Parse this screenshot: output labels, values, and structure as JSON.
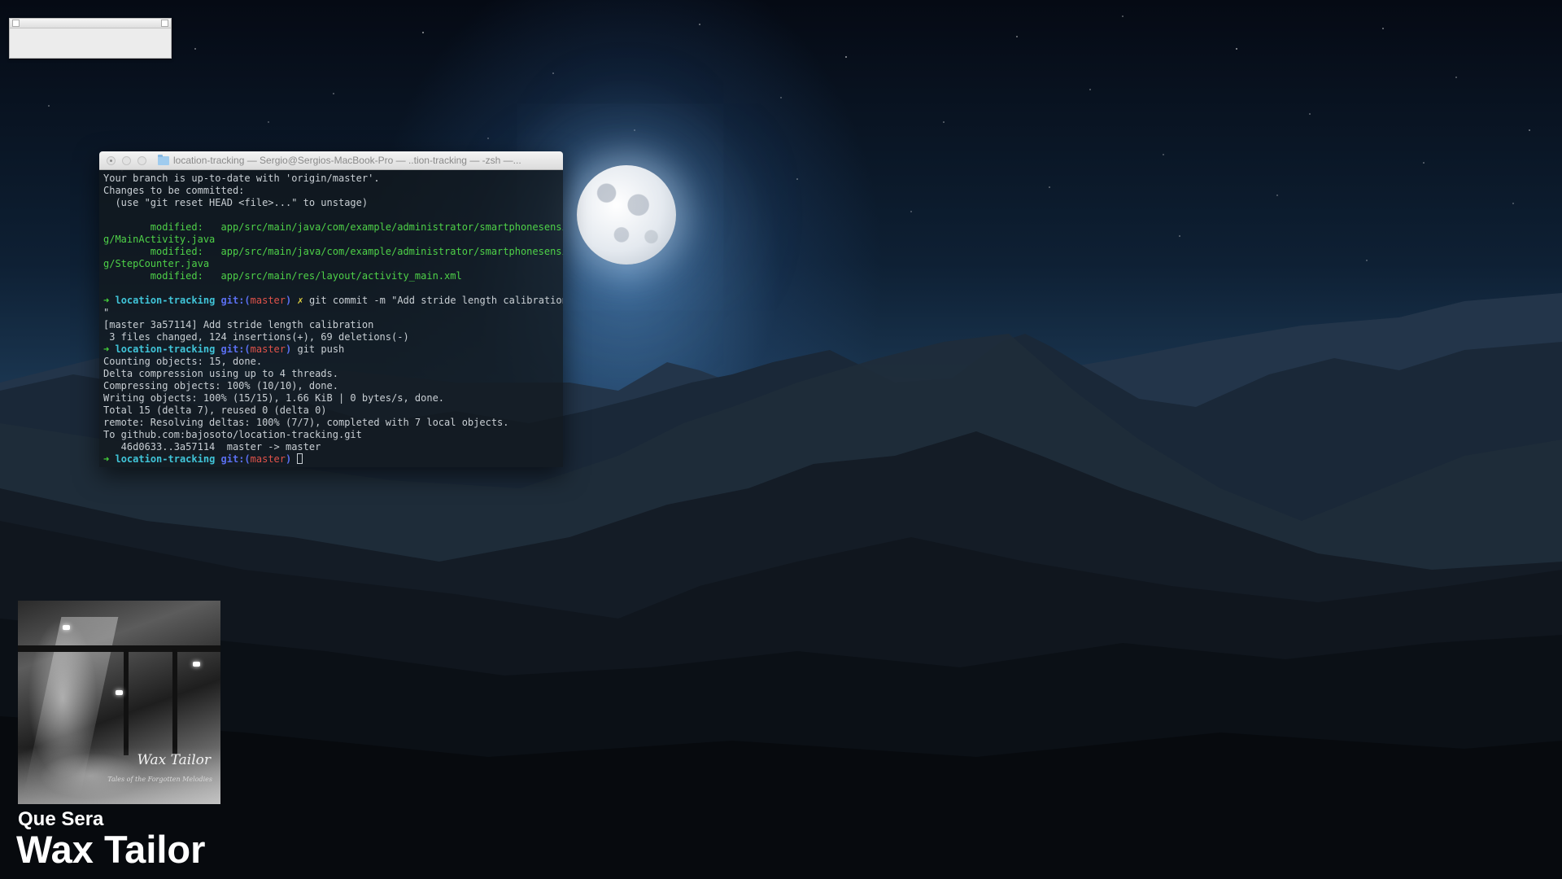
{
  "terminal": {
    "title": "location-tracking — Sergio@Sergios-MacBook-Pro — ..tion-tracking — -zsh —...",
    "prompt": {
      "arrow": "➜",
      "dir": "location-tracking",
      "git_label": "git:(",
      "branch": "master",
      "git_close": ")",
      "dirty_mark": "✗"
    },
    "lines": {
      "l1": "Your branch is up-to-date with 'origin/master'.",
      "l2": "Changes to be committed:",
      "l3": "  (use \"git reset HEAD <file>...\" to unstage)",
      "m1a": "        modified:   app/src/main/java/com/example/administrator/smartphonesensin",
      "m1b": "g/MainActivity.java",
      "m2a": "        modified:   app/src/main/java/com/example/administrator/smartphonesensin",
      "m2b": "g/StepCounter.java",
      "m3": "        modified:   app/src/main/res/layout/activity_main.xml",
      "cmd1": "git commit -m \"Add stride length calibration",
      "cmd1_cont": "\"",
      "c1": "[master 3a57114] Add stride length calibration",
      "c2": " 3 files changed, 124 insertions(+), 69 deletions(-)",
      "cmd2": "git push",
      "p1": "Counting objects: 15, done.",
      "p2": "Delta compression using up to 4 threads.",
      "p3": "Compressing objects: 100% (10/10), done.",
      "p4": "Writing objects: 100% (15/15), 1.66 KiB | 0 bytes/s, done.",
      "p5": "Total 15 (delta 7), reused 0 (delta 0)",
      "p6": "remote: Resolving deltas: 100% (7/7), completed with 7 local objects.",
      "p7": "To github.com:bajosoto/location-tracking.git",
      "p8": "   46d0633..3a57114  master -> master"
    }
  },
  "now_playing": {
    "track": "Que Sera",
    "artist": "Wax Tailor",
    "album_art_script": "Wax Tailor",
    "album_art_subtitle": "Tales of the Forgotten Melodies"
  },
  "colors": {
    "prompt_arrow": "#47d63b",
    "dir": "#40c4d8",
    "git": "#5a6ff0",
    "branch": "#e0524a",
    "dirty": "#e5d441",
    "modified": "#4ed148"
  }
}
